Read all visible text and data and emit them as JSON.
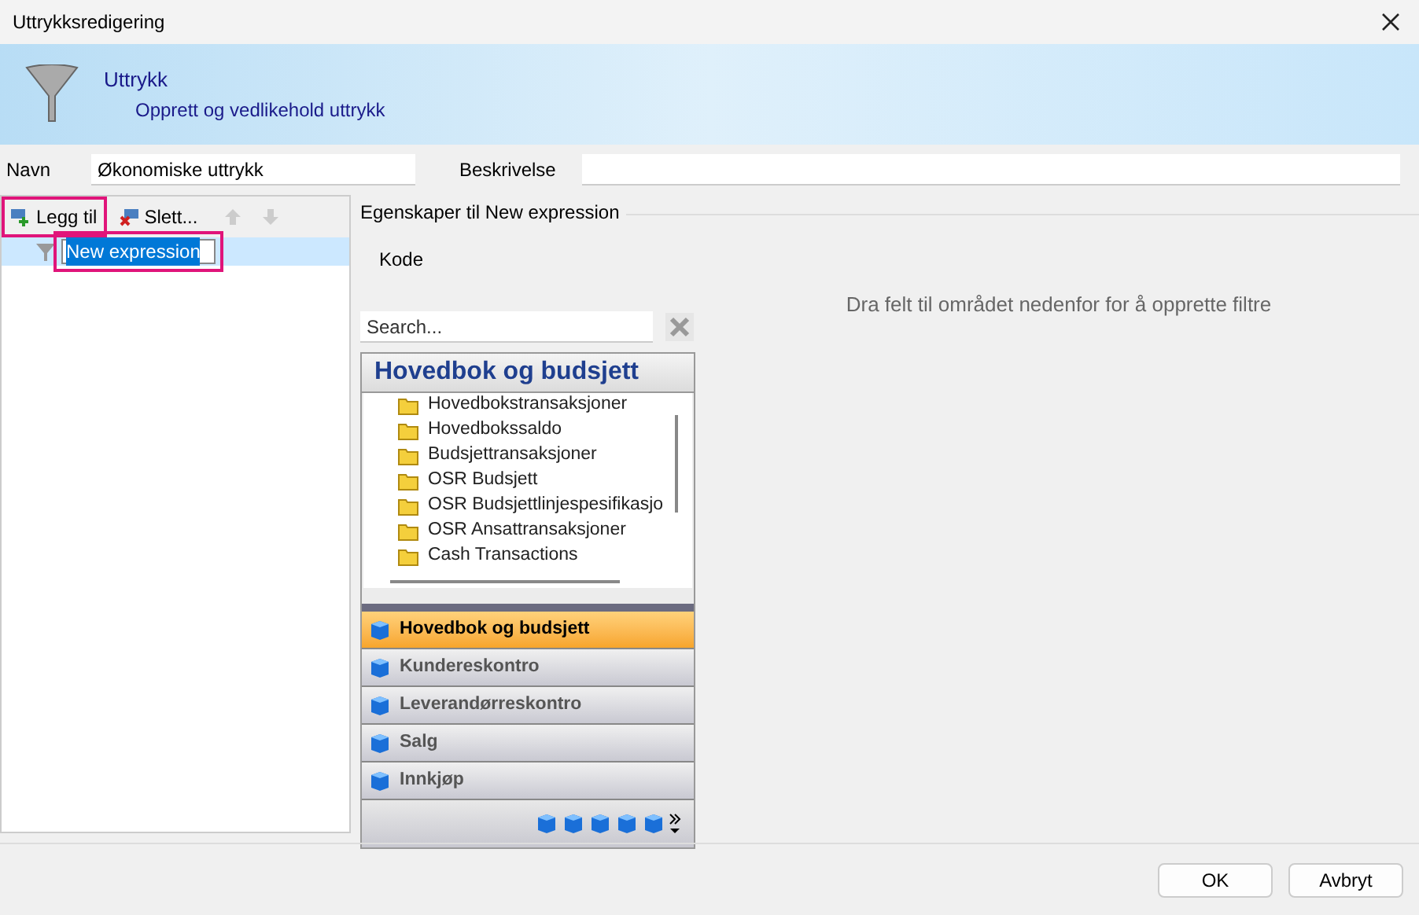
{
  "window": {
    "title": "Uttrykksredigering"
  },
  "header": {
    "title": "Uttrykk",
    "subtitle": "Opprett og vedlikehold uttrykk"
  },
  "form": {
    "name_label": "Navn",
    "name_value": "Økonomiske uttrykk",
    "description_label": "Beskrivelse"
  },
  "toolbar": {
    "add": "Legg til",
    "delete": "Slett..."
  },
  "tree": {
    "items": [
      {
        "label": "New expression",
        "selected": true
      }
    ]
  },
  "properties": {
    "title": "Egenskaper til New expression",
    "code_label": "Kode",
    "hint": "Dra felt til området nedenfor for å opprette filtre"
  },
  "search": {
    "placeholder": "Search..."
  },
  "navigator": {
    "title": "Hovedbok og budsjett",
    "folders": [
      "Hovedbokstransaksjoner",
      "Hovedbokssaldo",
      "Budsjettransaksjoner",
      "OSR Budsjett",
      "OSR Budsjettlinjespesifikasjo",
      "OSR Ansattransaksjoner",
      "Cash Transactions"
    ],
    "groups": [
      {
        "label": "Hovedbok og budsjett",
        "selected": true
      },
      {
        "label": "Kundereskontro",
        "selected": false
      },
      {
        "label": "Leverandørreskontro",
        "selected": false
      },
      {
        "label": "Salg",
        "selected": false
      },
      {
        "label": "Innkjøp",
        "selected": false
      }
    ]
  },
  "buttons": [
    "OK",
    "Avbryt"
  ]
}
